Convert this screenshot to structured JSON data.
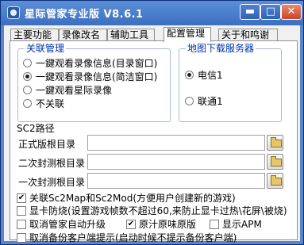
{
  "window": {
    "title": "星际管家专业版 V8.6.1",
    "min_glyph": "▬",
    "max_glyph": "□",
    "close_glyph": "✕"
  },
  "tabs": [
    "主要功能",
    "录像改名",
    "辅助工具",
    "配置管理",
    "关于和鸣谢"
  ],
  "active_tab": "配置管理",
  "association": {
    "title": "关联管理",
    "options": [
      {
        "label": "一鍵观看录像信息(目录窗口)",
        "selected": false
      },
      {
        "label": "一鍵观看录像信息(简洁窗口)",
        "selected": true
      },
      {
        "label": "一鍵观看星际录像",
        "selected": false
      },
      {
        "label": "不关联",
        "selected": false
      }
    ]
  },
  "map_server": {
    "title": "地图下载服务器",
    "options": [
      {
        "label": "电信1",
        "selected": true
      },
      {
        "label": "联通1",
        "selected": false
      }
    ]
  },
  "sc2_paths": {
    "title": "SC2路径",
    "rows": [
      {
        "label": "正式版根目录",
        "value": ""
      },
      {
        "label": "二次封测根目录",
        "value": ""
      },
      {
        "label": "一次封测根目录",
        "value": ""
      }
    ]
  },
  "options": {
    "associate_maps": {
      "label": "关联Sc2Map和Sc2Mod(方便用户创建新的游戏)",
      "checked": true
    },
    "gpu_protect": {
      "label": "显卡防烧(设置游戏帧数不超过60,来防止显卡过热\\花屏\\被烧)",
      "checked": false
    },
    "cancel_autoupgrade": {
      "label": "取消管家自动升级",
      "checked": false
    },
    "original_version": {
      "label": "原汁原味原版",
      "checked": true
    },
    "show_apm": {
      "label": "显示APM",
      "checked": false
    },
    "cancel_backup_prompt": {
      "label": "取消备份客户端提示(启动时候不提示备份客户端)",
      "checked": false
    }
  }
}
